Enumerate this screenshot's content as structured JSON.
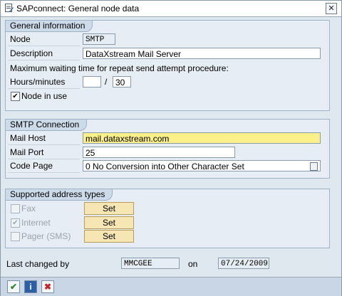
{
  "window": {
    "title": "SAPconnect: General node data",
    "close_label": "✕"
  },
  "general": {
    "header": "General information",
    "node_label": "Node",
    "node_value": "SMTP",
    "description_label": "Description",
    "description_value": "DataXstream Mail Server",
    "max_wait_text": "Maximum waiting time for repeat send attempt procedure:",
    "hours_minutes_label": "Hours/minutes",
    "hours_value": "",
    "separator": "/",
    "minutes_value": "30",
    "node_in_use_label": "Node in use",
    "node_in_use_checked": true
  },
  "smtp": {
    "header": "SMTP Connection",
    "mail_host_label": "Mail Host",
    "mail_host_value": "mail.dataxstream.com",
    "mail_port_label": "Mail Port",
    "mail_port_value": "25",
    "code_page_label": "Code Page",
    "code_page_value": "0 No Conversion into Other Character Set"
  },
  "address_types": {
    "header": "Supported address types",
    "items": [
      {
        "label": "Fax",
        "checked": false,
        "button": "Set"
      },
      {
        "label": "Internet",
        "checked": true,
        "button": "Set"
      },
      {
        "label": "Pager (SMS)",
        "checked": false,
        "button": "Set"
      }
    ]
  },
  "footer": {
    "last_changed_label": "Last changed by",
    "last_changed_value": "MMCGEE",
    "on_label": "on",
    "date_value": "07/24/2009",
    "buttons": {
      "confirm_glyph": "✔",
      "info_glyph": "i",
      "cancel_glyph": "✖"
    }
  }
}
